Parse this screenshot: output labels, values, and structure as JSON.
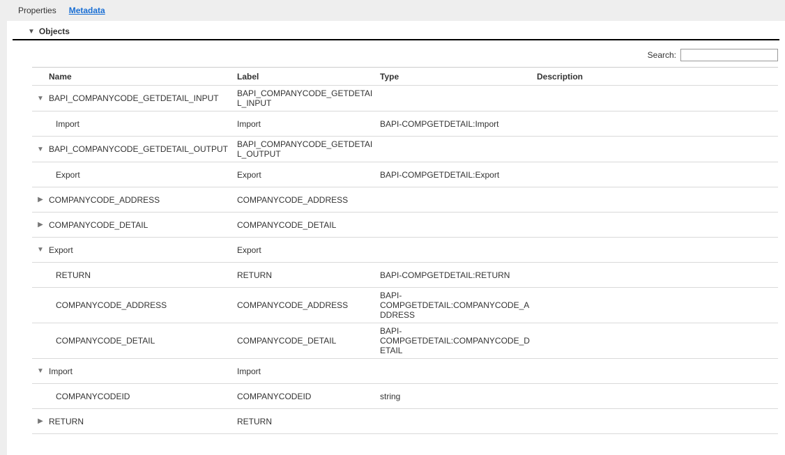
{
  "tabs": {
    "properties": "Properties",
    "metadata": "Metadata"
  },
  "section_title": "Objects",
  "search_label": "Search:",
  "columns": {
    "name": "Name",
    "label": "Label",
    "type": "Type",
    "description": "Description"
  },
  "rows": [
    {
      "toggle": "down",
      "indent": 0,
      "name": "BAPI_COMPANYCODE_GETDETAIL_INPUT",
      "label": "BAPI_COMPANYCODE_GETDETAIL_INPUT",
      "type": "",
      "desc": ""
    },
    {
      "toggle": "",
      "indent": 1,
      "name": "Import",
      "label": "Import",
      "type": "BAPI-COMPGETDETAIL:Import",
      "desc": ""
    },
    {
      "toggle": "down",
      "indent": 0,
      "name": "BAPI_COMPANYCODE_GETDETAIL_OUTPUT",
      "label": "BAPI_COMPANYCODE_GETDETAIL_OUTPUT",
      "type": "",
      "desc": ""
    },
    {
      "toggle": "",
      "indent": 1,
      "name": "Export",
      "label": "Export",
      "type": "BAPI-COMPGETDETAIL:Export",
      "desc": ""
    },
    {
      "toggle": "right",
      "indent": 0,
      "name": "COMPANYCODE_ADDRESS",
      "label": "COMPANYCODE_ADDRESS",
      "type": "",
      "desc": ""
    },
    {
      "toggle": "right",
      "indent": 0,
      "name": "COMPANYCODE_DETAIL",
      "label": "COMPANYCODE_DETAIL",
      "type": "",
      "desc": ""
    },
    {
      "toggle": "down",
      "indent": 0,
      "name": "Export",
      "label": "Export",
      "type": "",
      "desc": ""
    },
    {
      "toggle": "",
      "indent": 1,
      "name": "RETURN",
      "label": "RETURN",
      "type": "BAPI-COMPGETDETAIL:RETURN",
      "desc": ""
    },
    {
      "toggle": "",
      "indent": 1,
      "name": "COMPANYCODE_ADDRESS",
      "label": "COMPANYCODE_ADDRESS",
      "type": "BAPI-COMPGETDETAIL:COMPANYCODE_ADDRESS",
      "desc": ""
    },
    {
      "toggle": "",
      "indent": 1,
      "name": "COMPANYCODE_DETAIL",
      "label": "COMPANYCODE_DETAIL",
      "type": "BAPI-COMPGETDETAIL:COMPANYCODE_DETAIL",
      "desc": ""
    },
    {
      "toggle": "down",
      "indent": 0,
      "name": "Import",
      "label": "Import",
      "type": "",
      "desc": ""
    },
    {
      "toggle": "",
      "indent": 1,
      "name": "COMPANYCODEID",
      "label": "COMPANYCODEID",
      "type": "string",
      "desc": ""
    },
    {
      "toggle": "right",
      "indent": 0,
      "name": "RETURN",
      "label": "RETURN",
      "type": "",
      "desc": ""
    }
  ]
}
